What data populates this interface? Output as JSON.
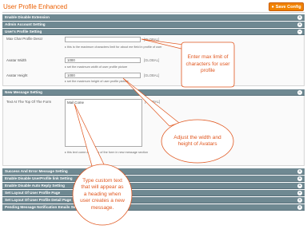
{
  "page": {
    "title": "User Profile Enhanced",
    "save_label": "Save Config"
  },
  "sections_top": [
    {
      "label": "Enable Disable Extension"
    },
    {
      "label": "Admin Account Setting"
    },
    {
      "label": "User's Profile Setting"
    }
  ],
  "profile": {
    "max_char": {
      "label": "Max Char Profile Descr",
      "value": "",
      "scope": "[GLOBAL]",
      "note": "this is the maximum characters limit for about me field in profile of user"
    },
    "avatar_width": {
      "label": "Avatar Width",
      "value": "1000",
      "scope": "[GLOBAL]",
      "note": "set the maximum width of user profile picture"
    },
    "avatar_height": {
      "label": "Avatar Height",
      "value": "1000",
      "scope": "[GLOBAL]",
      "note": "set the maximum height of user profile picture"
    }
  },
  "new_message": {
    "section_label": "New Message Setting",
    "text_label": "Text At The Top Of The Form",
    "text_value": "Mail Come",
    "scope": "[GLOBAL]",
    "note": "this text come at the top of the form in new message section"
  },
  "sections_bottom": [
    {
      "label": "Success And Error Message Setting"
    },
    {
      "label": "Enable Disable UserProfile link Setting"
    },
    {
      "label": "Enable Disable Auto Reply Setting"
    },
    {
      "label": "Set Layout Of User Profile Page"
    },
    {
      "label": "Set Layout Of User Profile Detail Page"
    },
    {
      "label": "Pending Message Notification Emails Settings"
    }
  ],
  "callouts": {
    "max_char": "Enter max limit of characters for user profile",
    "avatar": "Adjust the width and height of Avatars",
    "message": "Type custom text that will appear as a heading when user creates a new message."
  },
  "colors": {
    "accent": "#eb5e00",
    "section_header": "#6f8992",
    "callout": "#e0561e"
  },
  "icons": {
    "save": "save-icon",
    "toggle": "collapse-toggle-icon"
  }
}
